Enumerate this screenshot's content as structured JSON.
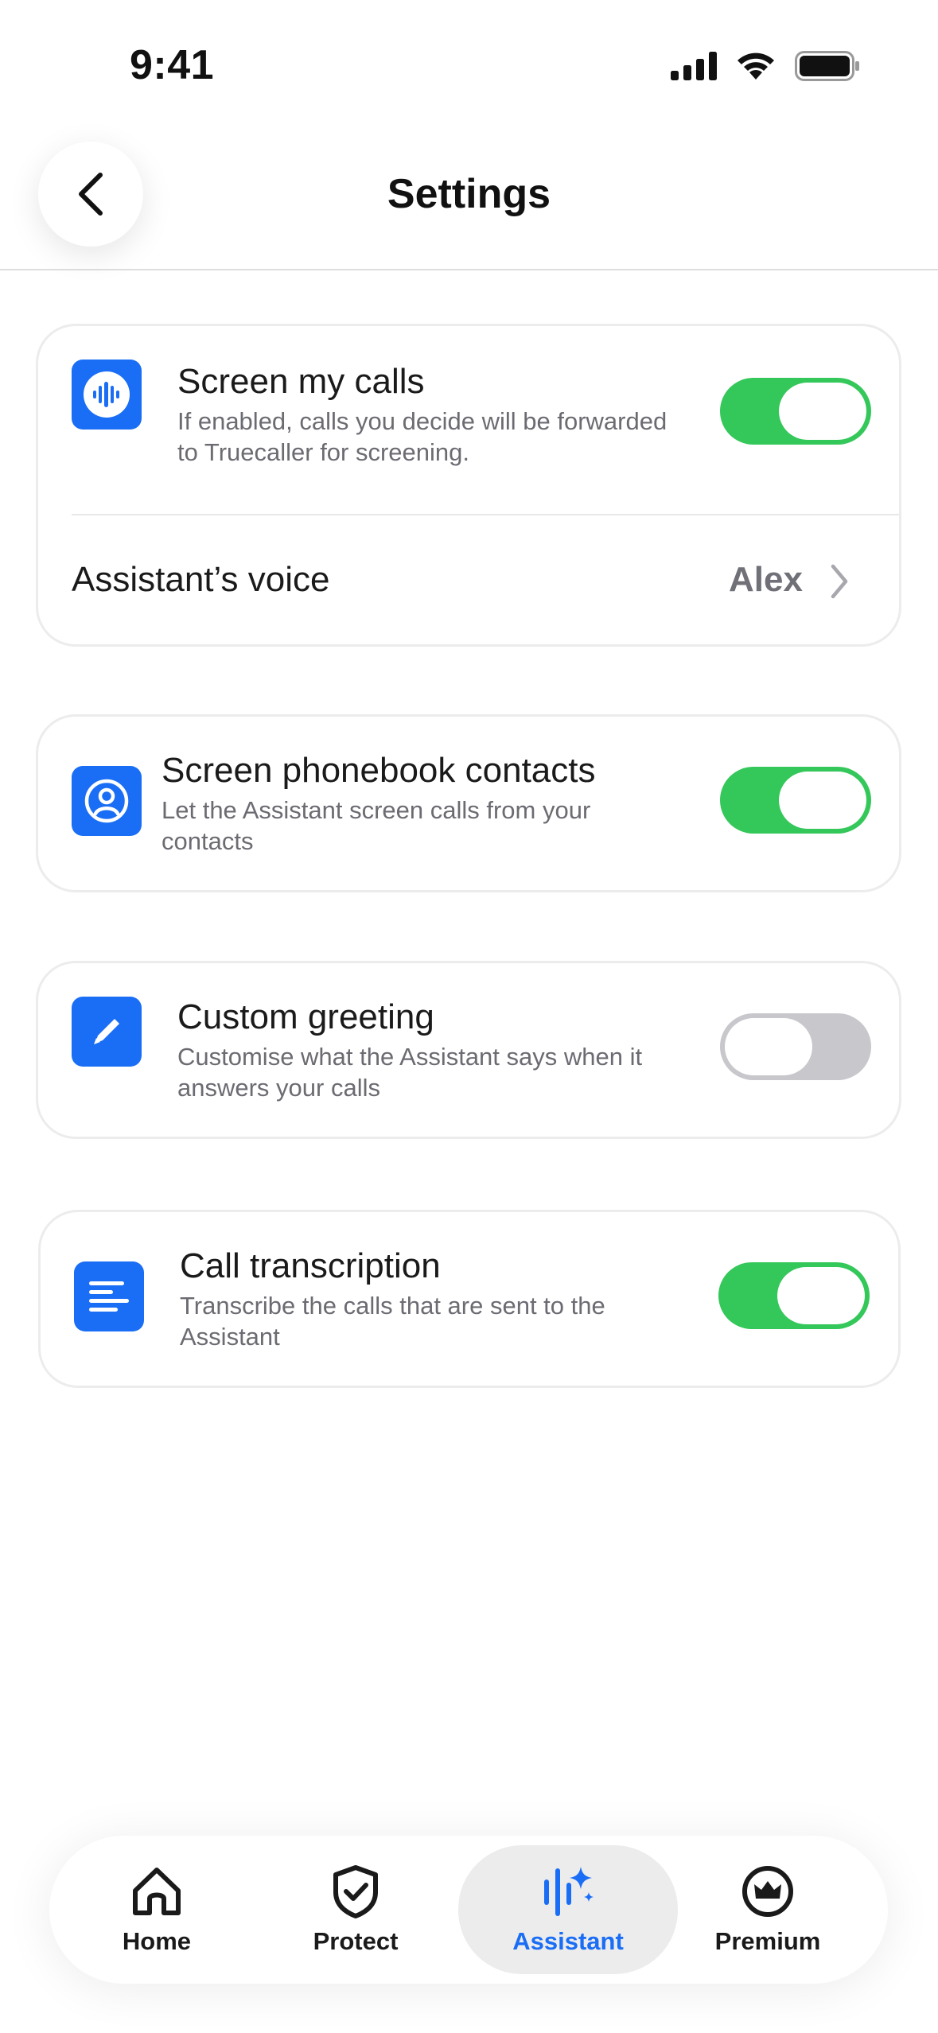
{
  "status_bar": {
    "time": "9:41"
  },
  "header": {
    "title": "Settings"
  },
  "cards": {
    "screen_calls": {
      "title": "Screen my calls",
      "subtitle": "If enabled, calls you decide will be forwarded to Truecaller for screening.",
      "toggle": "on",
      "icon": "voice-waveform-icon"
    },
    "voice": {
      "label": "Assistant’s voice",
      "value": "Alex"
    },
    "phonebook": {
      "title": "Screen phonebook contacts",
      "subtitle": "Let the Assistant screen calls from your contacts",
      "toggle": "on",
      "icon": "contact-icon"
    },
    "greeting": {
      "title": "Custom greeting",
      "subtitle": "Customise what the Assistant says when it answers your calls",
      "toggle": "off",
      "icon": "pencil-icon"
    },
    "transcription": {
      "title": "Call transcription",
      "subtitle": "Transcribe the calls that are sent to the Assistant",
      "toggle": "on",
      "icon": "transcript-lines-icon"
    }
  },
  "tabs": [
    {
      "label": "Home",
      "icon": "home-icon",
      "active": false
    },
    {
      "label": "Protect",
      "icon": "shield-check-icon",
      "active": false
    },
    {
      "label": "Assistant",
      "icon": "assistant-sparkle-icon",
      "active": true
    },
    {
      "label": "Premium",
      "icon": "crown-icon",
      "active": false
    }
  ],
  "colors": {
    "accent": "#1a6ef5",
    "toggle_on": "#34c759",
    "toggle_off": "#c7c7cc",
    "secondary_text": "#6b6b72"
  }
}
